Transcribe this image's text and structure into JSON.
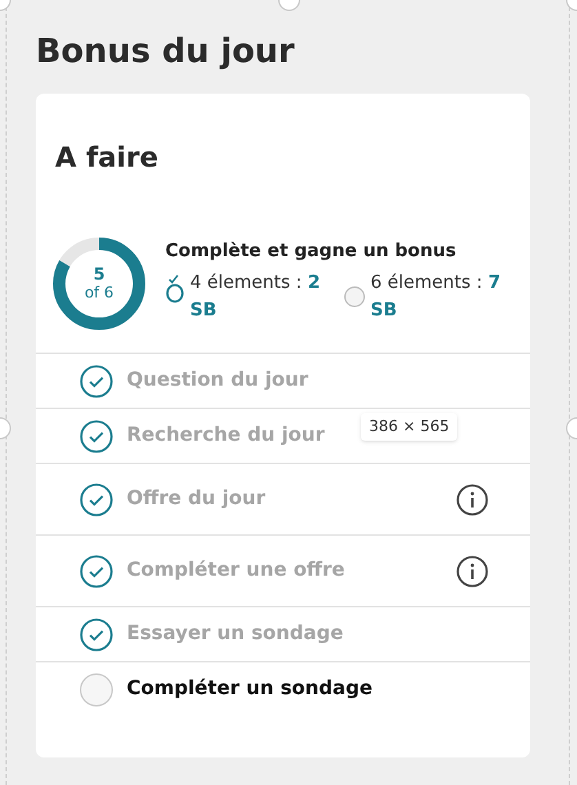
{
  "title": "Bonus du jour",
  "card": {
    "heading": "A faire",
    "progress": {
      "count": "5",
      "total": "of 6",
      "level": 0.8333
    },
    "bonus": {
      "title": "Complète et gagne un bonus",
      "milestones": [
        {
          "label": "4 élements : **2 SB**",
          "reached": true
        },
        {
          "label": "6 élements : **7 SB**",
          "reached": false
        }
      ]
    },
    "tasks": [
      {
        "label": "Question du jour",
        "done": true,
        "info": false
      },
      {
        "label": "Recherche du jour",
        "done": true,
        "info": false
      },
      {
        "label": "Offre du jour",
        "done": true,
        "info": true
      },
      {
        "label": "Compléter une offre",
        "done": true,
        "info": true
      },
      {
        "label": "Essayer un sondage",
        "done": true,
        "info": false
      },
      {
        "label": "Compléter un sondage",
        "done": false,
        "info": false
      }
    ]
  },
  "size_tooltip": "386 × 565"
}
